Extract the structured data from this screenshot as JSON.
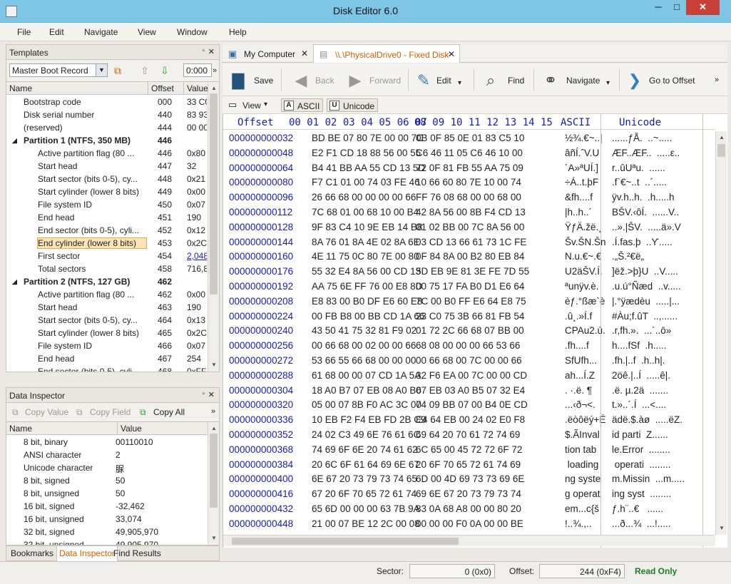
{
  "window": {
    "title": "Disk Editor 6.0",
    "min": "─",
    "max": "□",
    "close": "✕"
  },
  "menu": [
    "File",
    "Edit",
    "Navigate",
    "View",
    "Window",
    "Help"
  ],
  "templates_panel": {
    "title": "Templates",
    "selected_template": "Master Boot Record",
    "offset_value": "0:000",
    "more": "»",
    "columns": [
      "Name",
      "Offset",
      "Value"
    ],
    "rows": [
      {
        "name": "Bootstrap code",
        "offset": "000",
        "value": "33 C0",
        "level": 1
      },
      {
        "name": "Disk serial number",
        "offset": "440",
        "value": "83 93",
        "level": 1
      },
      {
        "name": "(reserved)",
        "offset": "444",
        "value": "00 00",
        "level": 1
      },
      {
        "name": "Partition 1 (NTFS, 350 MB)",
        "offset": "446",
        "value": "",
        "level": 0,
        "group": true
      },
      {
        "name": "Active partition flag (80 ...",
        "offset": "446",
        "value": "0x80",
        "level": 2
      },
      {
        "name": "Start head",
        "offset": "447",
        "value": "32",
        "level": 2
      },
      {
        "name": "Start sector (bits 0-5), cy...",
        "offset": "448",
        "value": "0x21",
        "level": 2
      },
      {
        "name": "Start cylinder (lower 8 bits)",
        "offset": "449",
        "value": "0x00",
        "level": 2
      },
      {
        "name": "File system ID",
        "offset": "450",
        "value": "0x07",
        "level": 2
      },
      {
        "name": "End head",
        "offset": "451",
        "value": "190",
        "level": 2
      },
      {
        "name": "End sector (bits 0-5), cyli...",
        "offset": "452",
        "value": "0x12",
        "level": 2
      },
      {
        "name": "End cylinder (lower 8 bits)",
        "offset": "453",
        "value": "0x2C",
        "level": 2,
        "selected": true
      },
      {
        "name": "First sector",
        "offset": "454",
        "value": "2,048",
        "level": 2,
        "link": true
      },
      {
        "name": "Total sectors",
        "offset": "458",
        "value": "716,8",
        "level": 2
      },
      {
        "name": "Partition 2 (NTFS, 127 GB)",
        "offset": "462",
        "value": "",
        "level": 0,
        "group": true
      },
      {
        "name": "Active partition flag (80 ...",
        "offset": "462",
        "value": "0x00",
        "level": 2
      },
      {
        "name": "Start head",
        "offset": "463",
        "value": "190",
        "level": 2
      },
      {
        "name": "Start sector (bits 0-5), cy...",
        "offset": "464",
        "value": "0x13",
        "level": 2
      },
      {
        "name": "Start cylinder (lower 8 bits)",
        "offset": "465",
        "value": "0x2C",
        "level": 2
      },
      {
        "name": "File system ID",
        "offset": "466",
        "value": "0x07",
        "level": 2
      },
      {
        "name": "End head",
        "offset": "467",
        "value": "254",
        "level": 2
      },
      {
        "name": "End sector (bits 0-5), cyli...",
        "offset": "468",
        "value": "0xFF",
        "level": 2
      }
    ]
  },
  "data_inspector": {
    "title": "Data Inspector",
    "copy_value": "Copy Value",
    "copy_field": "Copy Field",
    "copy_all": "Copy All",
    "more": "»",
    "columns": [
      "Name",
      "Value"
    ],
    "rows": [
      {
        "name": "8 bit, binary",
        "value": "00110010"
      },
      {
        "name": "ANSI character",
        "value": "2"
      },
      {
        "name": "Unicode character",
        "value": "脲"
      },
      {
        "name": "8 bit, signed",
        "value": "50"
      },
      {
        "name": "8 bit, unsigned",
        "value": "50"
      },
      {
        "name": "16 bit, signed",
        "value": "-32,462"
      },
      {
        "name": "16 bit, unsigned",
        "value": "33,074"
      },
      {
        "name": "32 bit, signed",
        "value": "49,905,970"
      },
      {
        "name": "32 bit, unsigned",
        "value": "49,905,970"
      }
    ]
  },
  "bottom_tabs": [
    "Bookmarks",
    "Data Inspector",
    "Find Results"
  ],
  "doc_tabs": [
    {
      "label": "My Computer",
      "close": "✕"
    },
    {
      "label": "\\\\.\\PhysicalDrive0 - Fixed Disk",
      "close": "✕"
    }
  ],
  "toolbar": {
    "save": "Save",
    "back": "Back",
    "forward": "Forward",
    "edit": "Edit",
    "find": "Find",
    "navigate": "Navigate",
    "goto": "Go to Offset",
    "more": "»",
    "dropdown": "▾"
  },
  "view_toolbar": {
    "view": "View",
    "ascii": "ASCII",
    "unicode": "Unicode",
    "ascii_key": "A",
    "unicode_key": "U"
  },
  "hex": {
    "header_offset": "Offset",
    "header_bytes_1": "00 01 02 03 04 05 06 07",
    "header_bytes_2": "08 09 10 11 12 13 14 15",
    "header_ascii": "ASCII",
    "header_unicode": "Unicode",
    "rows": [
      {
        "offset": "000000000032",
        "b1": "BD BE 07 80 7E 00 00 7C",
        "b2": "0B 0F 85 0E 01 83 C5 10",
        "ascii": "½¾.€~..|",
        "unicode": "......ƒÅ.  ..~....."
      },
      {
        "offset": "000000000048",
        "b1": "E2 F1 CD 18 88 56 00 55",
        "b2": "C6 46 11 05 C6 46 10 00",
        "ascii": "âñÍ.ˆV.U",
        "unicode": "ÆF..ÆF..  .....ε.."
      },
      {
        "offset": "000000000064",
        "b1": "B4 41 BB AA 55 CD 13 5D",
        "b2": "72 0F 81 FB 55 AA 75 09",
        "ascii": "´A»ªUÍ.]",
        "unicode": "r..ûUªu.  ......"
      },
      {
        "offset": "000000000080",
        "b1": "F7 C1 01 00 74 03 FE 46",
        "b2": "10 66 60 80 7E 10 00 74",
        "ascii": "÷Á..t.þF",
        "unicode": ".f`€~..t  ..´....."
      },
      {
        "offset": "000000000096",
        "b1": "26 66 68 00 00 00 00 66",
        "b2": "FF 76 08 68 00 00 68 00",
        "ascii": "&fh....f",
        "unicode": "ÿv.h..h.  .h.....h"
      },
      {
        "offset": "000000000112",
        "b1": "7C 68 01 00 68 10 00 B4",
        "b2": "42 8A 56 00 8B F4 CD 13",
        "ascii": "|h..h..´",
        "unicode": "BŠV.‹ôÍ.  ......V.."
      },
      {
        "offset": "000000000128",
        "b1": "9F 83 C4 10 9E EB 14 B8",
        "b2": "01 02 BB 00 7C 8A 56 00",
        "ascii": "ŸƒÄ.žë.¸",
        "unicode": "..».|ŠV.  .....ä».V"
      },
      {
        "offset": "000000000144",
        "b1": "8A 76 01 8A 4E 02 8A 6E",
        "b2": "03 CD 13 66 61 73 1C FE",
        "ascii": "Šv.ŠN.Šn",
        "unicode": ".Í.fas.þ  ..Ƴ....."
      },
      {
        "offset": "000000000160",
        "b1": "4E 11 75 0C 80 7E 00 80",
        "b2": "0F 84 8A 00 B2 80 EB 84",
        "ascii": "N.u.€~.€",
        "unicode": ".„Š.²€ë„"
      },
      {
        "offset": "000000000176",
        "b1": "55 32 E4 8A 56 00 CD 13",
        "b2": "5D EB 9E 81 3E FE 7D 55",
        "ascii": "U2äŠV.Í.",
        "unicode": "]ëž.>þ}U  ..V....."
      },
      {
        "offset": "000000000192",
        "b1": "AA 75 6E FF 76 00 E8 8D",
        "b2": "00 75 17 FA B0 D1 E6 64",
        "ascii": "ªunÿv.è.",
        "unicode": ".u.ú°Ñæd  ..v....."
      },
      {
        "offset": "000000000208",
        "b1": "E8 83 00 B0 DF E6 60 E8",
        "b2": "7C 00 B0 FF E6 64 E8 75",
        "ascii": "èƒ.°ßæ`è",
        "unicode": "|.°ÿædèu  .....|..."
      },
      {
        "offset": "000000000224",
        "b1": "00 FB B8 00 BB CD 1A 66",
        "b2": "23 C0 75 3B 66 81 FB 54",
        "ascii": ".û¸.»Í.f",
        "unicode": "#Àu;f.ûT  ..,......"
      },
      {
        "offset": "000000000240",
        "b1": "43 50 41 75 32 81 F9 02",
        "b2": "01 72 2C 66 68 07 BB 00",
        "ascii": "CPAu2.ù.",
        "unicode": ".r,fh.».  ...´..ō»"
      },
      {
        "offset": "000000000256",
        "b1": "00 66 68 00 02 00 00 66",
        "b2": "68 08 00 00 00 66 53 66",
        "ascii": ".fh....f",
        "unicode": "h....fSf  .h....."
      },
      {
        "offset": "000000000272",
        "b1": "53 66 55 66 68 00 00 00",
        "b2": "00 66 68 00 7C 00 00 66",
        "ascii": "SfUfh...",
        "unicode": ".fh.|..f  .h..h|."
      },
      {
        "offset": "000000000288",
        "b1": "61 68 00 00 07 CD 1A 5A",
        "b2": "32 F6 EA 00 7C 00 00 CD",
        "ascii": "ah...Í.Z",
        "unicode": "2öê.|..Í  .....ê|."
      },
      {
        "offset": "000000000304",
        "b1": "18 A0 B7 07 EB 08 A0 B6",
        "b2": "07 EB 03 A0 B5 07 32 E4",
        "ascii": ". ·.ë. ¶",
        "unicode": ".ë. µ.2ä  ......."
      },
      {
        "offset": "000000000320",
        "b1": "05 00 07 8B F0 AC 3C 00",
        "b2": "74 09 BB 07 00 B4 0E CD",
        "ascii": "...‹ð¬<.",
        "unicode": "t.»..´.Í  ...<...."
      },
      {
        "offset": "000000000336",
        "b1": "10 EB F2 F4 EB FD 2B C9",
        "b2": "E4 64 EB 00 24 02 E0 F8",
        "ascii": ".ëòôëý+É",
        "unicode": "ädë.$.àø  .....ëZ."
      },
      {
        "offset": "000000000352",
        "b1": "24 02 C3 49 6E 76 61 6C",
        "b2": "69 64 20 70 61 72 74 69",
        "ascii": "$.ÃInval",
        "unicode": "id parti  Ζ......"
      },
      {
        "offset": "000000000368",
        "b1": "74 69 6F 6E 20 74 61 62",
        "b2": "6C 65 00 45 72 72 6F 72",
        "ascii": "tion tab",
        "unicode": "le.Error  ........"
      },
      {
        "offset": "000000000384",
        "b1": "20 6C 6F 61 64 69 6E 67",
        "b2": "20 6F 70 65 72 61 74 69",
        "ascii": " loading",
        "unicode": " operati  ........"
      },
      {
        "offset": "000000000400",
        "b1": "6E 67 20 73 79 73 74 65",
        "b2": "6D 00 4D 69 73 73 69 6E",
        "ascii": "ng syste",
        "unicode": "m.Missin  ...m....."
      },
      {
        "offset": "000000000416",
        "b1": "67 20 6F 70 65 72 61 74",
        "b2": "69 6E 67 20 73 79 73 74",
        "ascii": "g operat",
        "unicode": "ing syst  ........"
      },
      {
        "offset": "000000000432",
        "b1": "65 6D 00 00 00 63 7B 9A",
        "b2": "83 0A 68 A8 00 00 80 20",
        "ascii": "em...c{š",
        "unicode": "ƒ.h¨..€   ......"
      },
      {
        "offset": "000000000448",
        "b1": "21 00 07 BE 12 2C 00 08",
        "b2": "00 00 00 F0 0A 00 00 BE",
        "ascii": "!..¾.,..",
        "unicode": "...ð...¾  ...!....."
      }
    ]
  },
  "status": {
    "sector_label": "Sector:",
    "sector_value": "0 (0x0)",
    "offset_label": "Offset:",
    "offset_value": "244 (0xF4)",
    "mode": "Read Only"
  }
}
